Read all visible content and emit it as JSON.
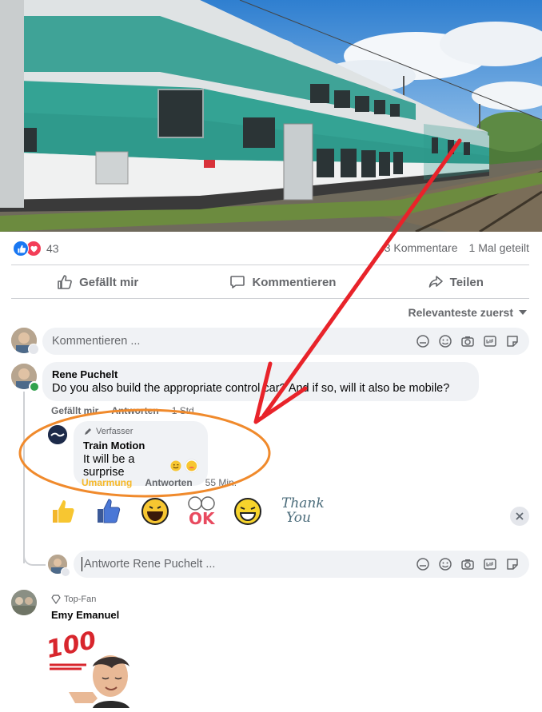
{
  "post": {
    "reaction_count": "43",
    "comments_count": "3 Kommentare",
    "shares_count": "1 Mal geteilt"
  },
  "actions": {
    "like": "Gefällt mir",
    "comment": "Kommentieren",
    "share": "Teilen"
  },
  "sort": {
    "label": "Relevanteste zuerst"
  },
  "composer": {
    "placeholder": "Kommentieren ..."
  },
  "comment1": {
    "author": "Rene Puchelt",
    "text": "Do you also build the appropriate control car? And if so, will it also be mobile?",
    "like": "Gefällt mir",
    "reply": "Antworten",
    "time": "1 Std."
  },
  "reply1": {
    "badge": "Verfasser",
    "author": "Train Motion",
    "text": "It will be a surprise",
    "reaction": "Umarmung",
    "reply": "Antworten",
    "time": "55 Min."
  },
  "stickers": {
    "ok": "OK",
    "thank": "Thank",
    "you": "You"
  },
  "reply_composer": {
    "placeholder": "Antworte Rene Puchelt ..."
  },
  "comment2": {
    "badge": "Top-Fan",
    "author": "Emy Emanuel",
    "sticker_text": "100"
  },
  "colors": {
    "annotation_arrow": "#e8232a",
    "annotation_ellipse": "#f08a2c",
    "accent": "#1877f2"
  }
}
